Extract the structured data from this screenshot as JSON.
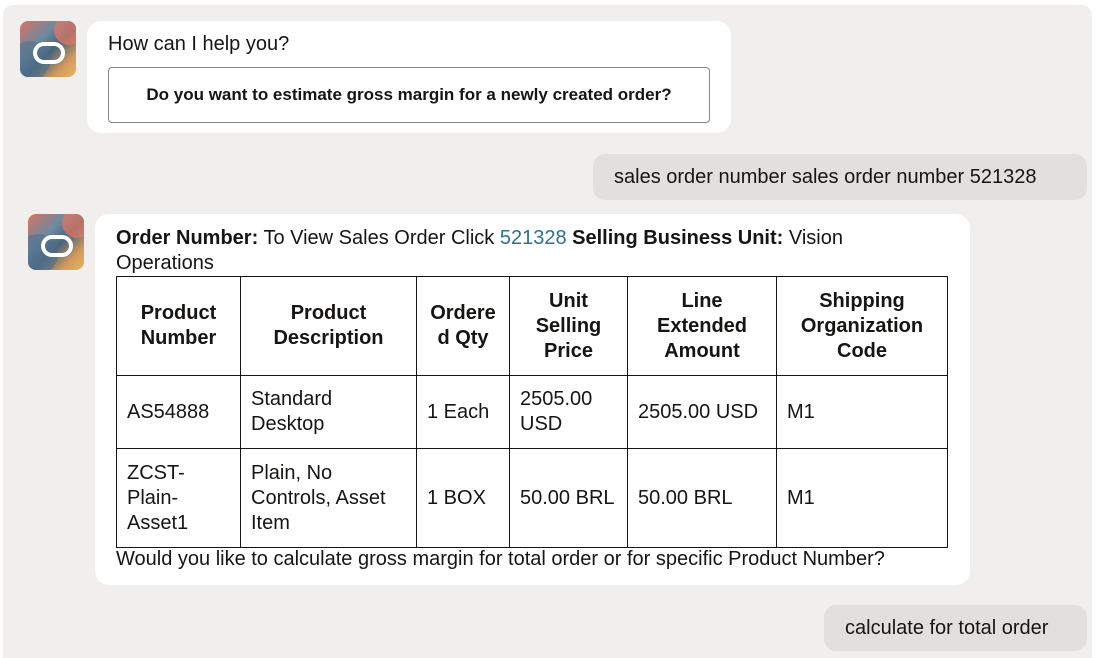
{
  "bot_message_1": {
    "greeting": "How can I help you?",
    "suggestion": "Do you want to estimate gross margin for a newly created order?"
  },
  "user_message_1": "sales order number sales order number 521328",
  "bot_message_2": {
    "order_label": "Order Number:",
    "view_text": "To View Sales Order Click",
    "order_link": "521328",
    "bu_label": "Selling Business Unit:",
    "bu_value": "Vision Operations",
    "table": {
      "headers": [
        "Product Number",
        "Product Description",
        "Ordered Qty",
        "Unit Selling Price",
        "Line Extended Amount",
        "Shipping Organization Code"
      ],
      "rows": [
        [
          "AS54888",
          "Standard Desktop",
          "1 Each",
          "2505.00 USD",
          "2505.00 USD",
          "M1"
        ],
        [
          "ZCST-Plain-Asset1",
          "Plain, No Controls, Asset Item",
          "1 BOX",
          "50.00 BRL",
          "50.00 BRL",
          "M1"
        ]
      ]
    },
    "followup": "Would you like to calculate gross margin for total order or for specific Product Number?"
  },
  "user_message_2": "calculate for total order",
  "colors": {
    "chat_background": "#f1efed",
    "bot_bubble": "#ffffff",
    "user_bubble": "#e2dfdc",
    "link": "#2f6f8f"
  },
  "icons": {
    "avatar": "oracle-digital-assistant-avatar"
  }
}
